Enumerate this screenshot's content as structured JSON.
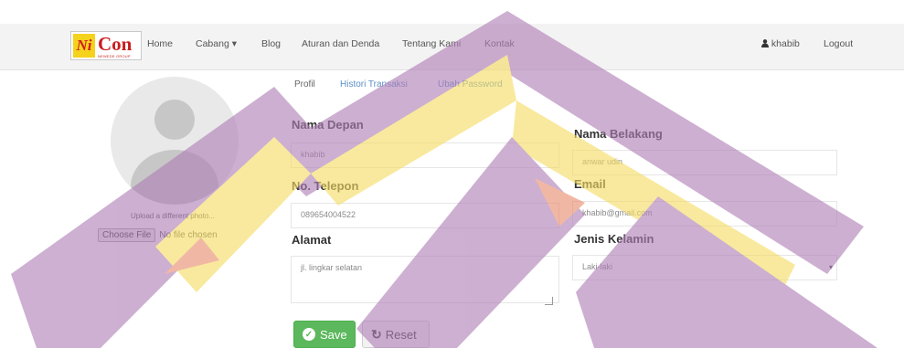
{
  "brand": {
    "logo_ni": "Ni",
    "logo_con": "Con",
    "logo_tagline": "NEWEDE GROUP"
  },
  "nav": {
    "home": "Home",
    "cabang": "Cabang",
    "cabang_caret": "▾",
    "blog": "Blog",
    "aturan": "Aturan dan Denda",
    "tentang": "Tentang Kami",
    "kontak": "Kontak",
    "user": "khabib",
    "logout": "Logout"
  },
  "tabs": [
    {
      "label": "Profil"
    },
    {
      "label": "Histori Transaksi"
    },
    {
      "label": "Ubah Password"
    }
  ],
  "upload": {
    "text": "Upload a different photo...",
    "choose_button": "Choose File",
    "no_file": "No file chosen"
  },
  "form": {
    "first_name_label": "Nama Depan",
    "first_name_value": "khabib",
    "last_name_label": "Nama Belakang",
    "last_name_value": "anwar udin",
    "phone_label": "No. Telepon",
    "phone_value": "089654004522",
    "email_label": "Email",
    "email_value": "khabib@gmail.com",
    "address_label": "Alamat",
    "address_value": "jl. lingkar selatan",
    "gender_label": "Jenis Kelamin",
    "gender_value": "Laki-laki"
  },
  "actions": {
    "save": "Save",
    "reset": "Reset"
  },
  "colors": {
    "save_green": "#5cb85c",
    "tab_link_blue": "#5c8fc6",
    "brand_red": "#c81e1e",
    "brand_yellow": "#f5d21c",
    "watermark_purple": "#b98cc0",
    "watermark_yellow": "#f7df6b"
  }
}
